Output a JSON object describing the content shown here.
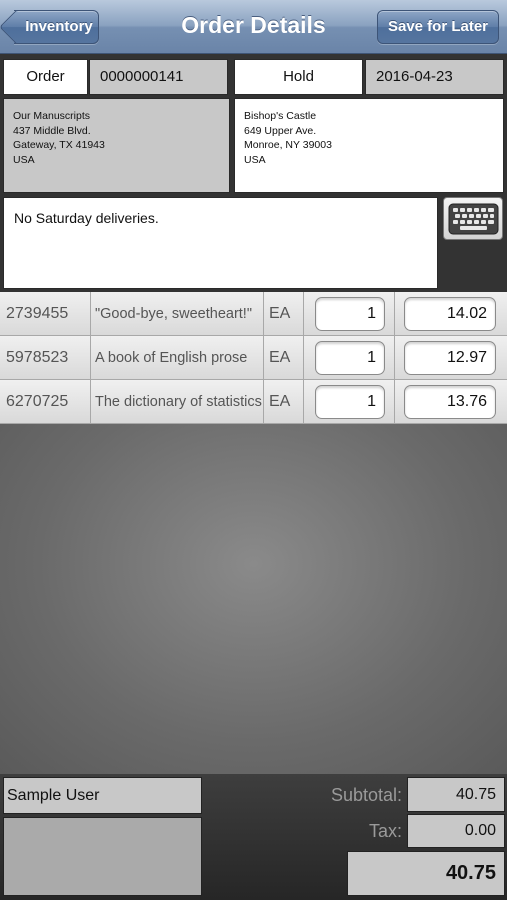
{
  "nav": {
    "title": "Order Details",
    "back_label": "Inventory",
    "save_label": "Save for Later"
  },
  "header": {
    "order_label": "Order",
    "order_number": "0000000141",
    "status": "Hold",
    "date": "2016-04-23"
  },
  "address_from": [
    "Our Manuscripts",
    "437 Middle Blvd.",
    "Gateway, TX 41943",
    "USA"
  ],
  "address_to": [
    "Bishop's Castle",
    "649 Upper Ave.",
    "Monroe, NY 39003",
    "USA"
  ],
  "notes": "No Saturday deliveries.",
  "keyboard_icon": "keyboard-icon",
  "items": [
    {
      "sku": "2739455",
      "description": "\"Good-bye, sweetheart!\"",
      "uom": "EA",
      "qty": "1",
      "price": "14.02"
    },
    {
      "sku": "5978523",
      "description": "A book of English prose",
      "uom": "EA",
      "qty": "1",
      "price": "12.97"
    },
    {
      "sku": "6270725",
      "description": "The dictionary of statistics",
      "uom": "EA",
      "qty": "1",
      "price": "13.76"
    }
  ],
  "footer": {
    "user": "Sample User",
    "subtotal_label": "Subtotal:",
    "subtotal": "40.75",
    "tax_label": "Tax:",
    "tax": "0.00",
    "total": "40.75"
  },
  "colors": {
    "nav_bar": "#7a93b5",
    "field_grey": "#c8c8c8",
    "background_dark": "#333333"
  }
}
